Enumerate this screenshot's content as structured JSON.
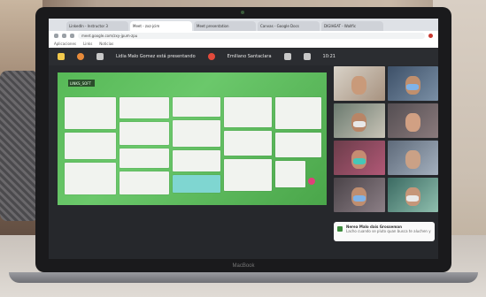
{
  "browser": {
    "tabs": [
      "LinkedIn - Instructor 3",
      "Meet - zxz-jcim",
      "Meet presentation",
      "Canvas - Google Docs",
      "DIGIHEAT - Wallfic"
    ],
    "url": "meet.google.com/zxy-jpum-zpu",
    "bookmarks": [
      "Aplicaciones",
      "Links",
      "Noticias"
    ]
  },
  "meet": {
    "presenting_label": "Lidia Malo Gomez está presentando",
    "presenter_name": "Emiliano Santaclara",
    "time": "10:21"
  },
  "board": {
    "title": "LINKS_SOFT"
  },
  "notification": {
    "name": "Nerea Malo dais Grosseman",
    "text": "Lacho cuando se pluto quan busca te aluchen y se pasan de cada anyitan fe..."
  },
  "laptop": {
    "brand": "MacBook"
  },
  "colors": {
    "board_green": "#57b957",
    "meet_bar": "#2b2d31",
    "fab_pink": "#e0407a"
  }
}
